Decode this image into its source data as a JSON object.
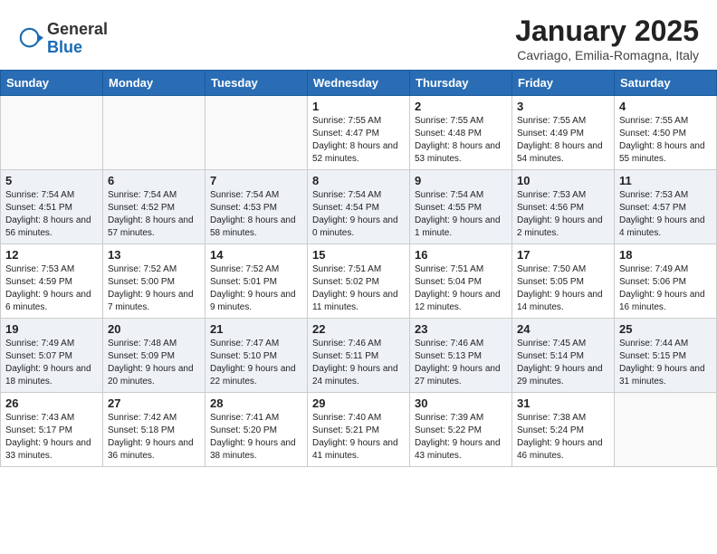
{
  "header": {
    "logo_general": "General",
    "logo_blue": "Blue",
    "month_title": "January 2025",
    "location": "Cavriago, Emilia-Romagna, Italy"
  },
  "days_of_week": [
    "Sunday",
    "Monday",
    "Tuesday",
    "Wednesday",
    "Thursday",
    "Friday",
    "Saturday"
  ],
  "weeks": [
    [
      {
        "day": "",
        "info": ""
      },
      {
        "day": "",
        "info": ""
      },
      {
        "day": "",
        "info": ""
      },
      {
        "day": "1",
        "info": "Sunrise: 7:55 AM\nSunset: 4:47 PM\nDaylight: 8 hours and 52 minutes."
      },
      {
        "day": "2",
        "info": "Sunrise: 7:55 AM\nSunset: 4:48 PM\nDaylight: 8 hours and 53 minutes."
      },
      {
        "day": "3",
        "info": "Sunrise: 7:55 AM\nSunset: 4:49 PM\nDaylight: 8 hours and 54 minutes."
      },
      {
        "day": "4",
        "info": "Sunrise: 7:55 AM\nSunset: 4:50 PM\nDaylight: 8 hours and 55 minutes."
      }
    ],
    [
      {
        "day": "5",
        "info": "Sunrise: 7:54 AM\nSunset: 4:51 PM\nDaylight: 8 hours and 56 minutes."
      },
      {
        "day": "6",
        "info": "Sunrise: 7:54 AM\nSunset: 4:52 PM\nDaylight: 8 hours and 57 minutes."
      },
      {
        "day": "7",
        "info": "Sunrise: 7:54 AM\nSunset: 4:53 PM\nDaylight: 8 hours and 58 minutes."
      },
      {
        "day": "8",
        "info": "Sunrise: 7:54 AM\nSunset: 4:54 PM\nDaylight: 9 hours and 0 minutes."
      },
      {
        "day": "9",
        "info": "Sunrise: 7:54 AM\nSunset: 4:55 PM\nDaylight: 9 hours and 1 minute."
      },
      {
        "day": "10",
        "info": "Sunrise: 7:53 AM\nSunset: 4:56 PM\nDaylight: 9 hours and 2 minutes."
      },
      {
        "day": "11",
        "info": "Sunrise: 7:53 AM\nSunset: 4:57 PM\nDaylight: 9 hours and 4 minutes."
      }
    ],
    [
      {
        "day": "12",
        "info": "Sunrise: 7:53 AM\nSunset: 4:59 PM\nDaylight: 9 hours and 6 minutes."
      },
      {
        "day": "13",
        "info": "Sunrise: 7:52 AM\nSunset: 5:00 PM\nDaylight: 9 hours and 7 minutes."
      },
      {
        "day": "14",
        "info": "Sunrise: 7:52 AM\nSunset: 5:01 PM\nDaylight: 9 hours and 9 minutes."
      },
      {
        "day": "15",
        "info": "Sunrise: 7:51 AM\nSunset: 5:02 PM\nDaylight: 9 hours and 11 minutes."
      },
      {
        "day": "16",
        "info": "Sunrise: 7:51 AM\nSunset: 5:04 PM\nDaylight: 9 hours and 12 minutes."
      },
      {
        "day": "17",
        "info": "Sunrise: 7:50 AM\nSunset: 5:05 PM\nDaylight: 9 hours and 14 minutes."
      },
      {
        "day": "18",
        "info": "Sunrise: 7:49 AM\nSunset: 5:06 PM\nDaylight: 9 hours and 16 minutes."
      }
    ],
    [
      {
        "day": "19",
        "info": "Sunrise: 7:49 AM\nSunset: 5:07 PM\nDaylight: 9 hours and 18 minutes."
      },
      {
        "day": "20",
        "info": "Sunrise: 7:48 AM\nSunset: 5:09 PM\nDaylight: 9 hours and 20 minutes."
      },
      {
        "day": "21",
        "info": "Sunrise: 7:47 AM\nSunset: 5:10 PM\nDaylight: 9 hours and 22 minutes."
      },
      {
        "day": "22",
        "info": "Sunrise: 7:46 AM\nSunset: 5:11 PM\nDaylight: 9 hours and 24 minutes."
      },
      {
        "day": "23",
        "info": "Sunrise: 7:46 AM\nSunset: 5:13 PM\nDaylight: 9 hours and 27 minutes."
      },
      {
        "day": "24",
        "info": "Sunrise: 7:45 AM\nSunset: 5:14 PM\nDaylight: 9 hours and 29 minutes."
      },
      {
        "day": "25",
        "info": "Sunrise: 7:44 AM\nSunset: 5:15 PM\nDaylight: 9 hours and 31 minutes."
      }
    ],
    [
      {
        "day": "26",
        "info": "Sunrise: 7:43 AM\nSunset: 5:17 PM\nDaylight: 9 hours and 33 minutes."
      },
      {
        "day": "27",
        "info": "Sunrise: 7:42 AM\nSunset: 5:18 PM\nDaylight: 9 hours and 36 minutes."
      },
      {
        "day": "28",
        "info": "Sunrise: 7:41 AM\nSunset: 5:20 PM\nDaylight: 9 hours and 38 minutes."
      },
      {
        "day": "29",
        "info": "Sunrise: 7:40 AM\nSunset: 5:21 PM\nDaylight: 9 hours and 41 minutes."
      },
      {
        "day": "30",
        "info": "Sunrise: 7:39 AM\nSunset: 5:22 PM\nDaylight: 9 hours and 43 minutes."
      },
      {
        "day": "31",
        "info": "Sunrise: 7:38 AM\nSunset: 5:24 PM\nDaylight: 9 hours and 46 minutes."
      },
      {
        "day": "",
        "info": ""
      }
    ]
  ]
}
